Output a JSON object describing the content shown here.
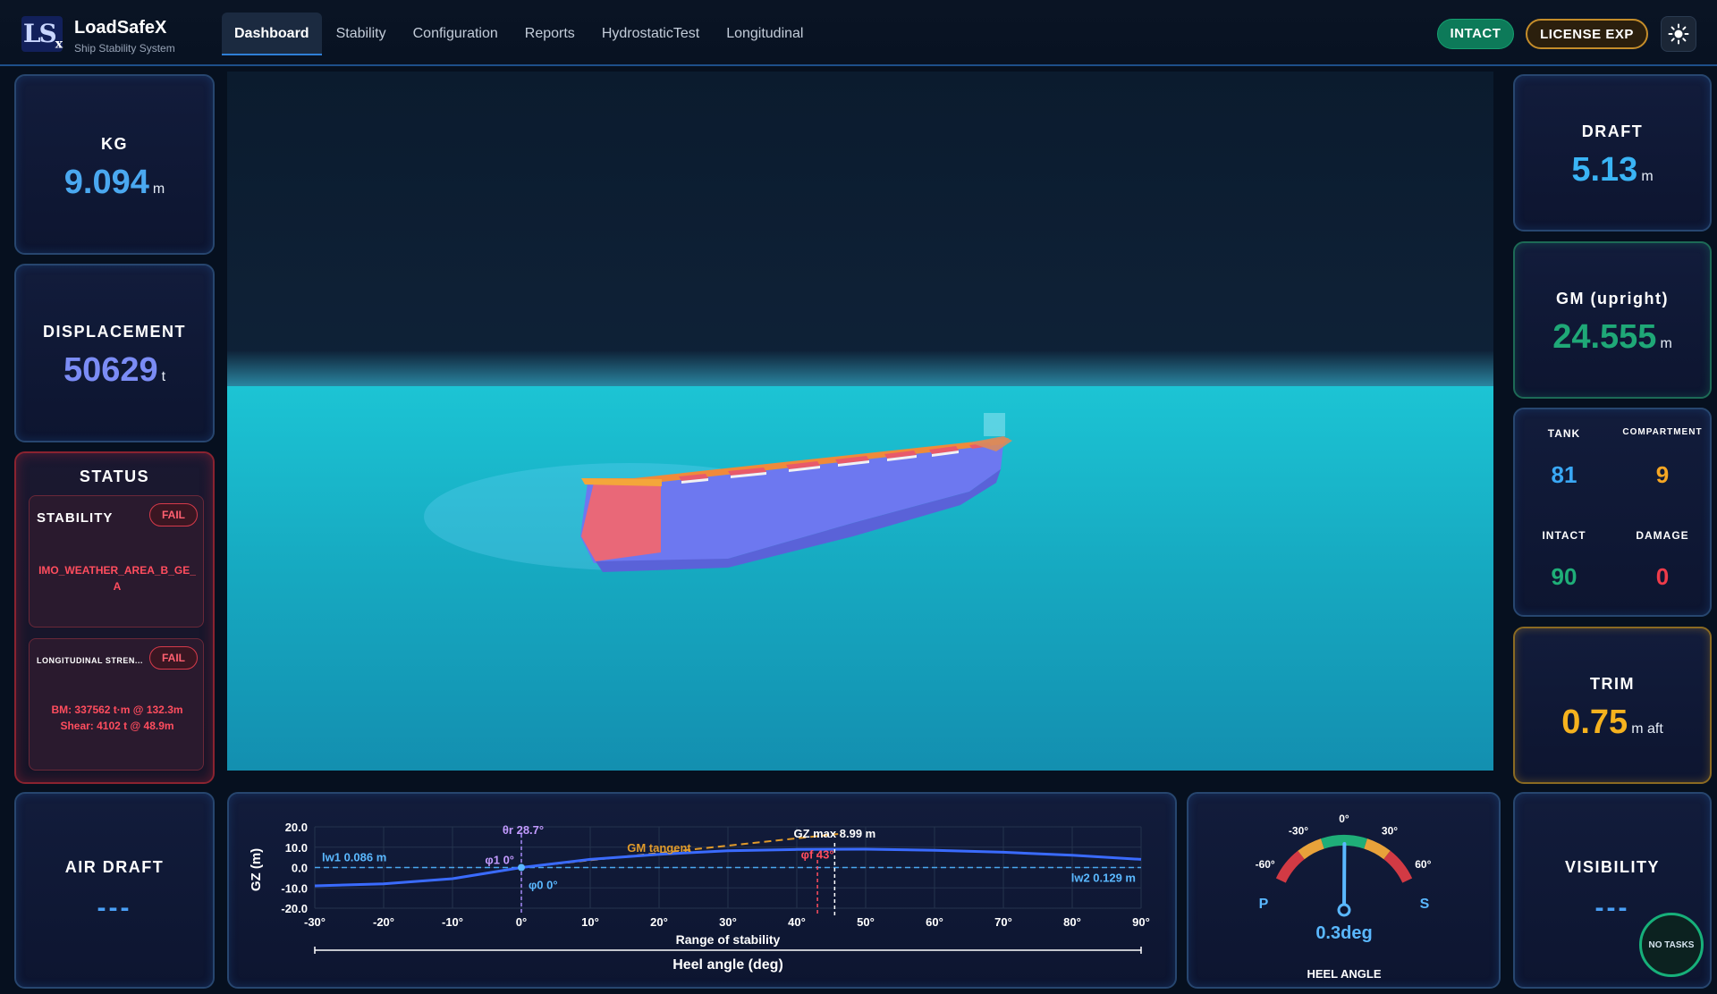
{
  "app": {
    "logo_text": "LS",
    "logo_sub": "x",
    "name": "LoadSafeX",
    "subtitle": "Ship Stability System"
  },
  "nav": {
    "tabs": [
      {
        "label": "Dashboard",
        "active": true
      },
      {
        "label": "Stability",
        "active": false
      },
      {
        "label": "Configuration",
        "active": false
      },
      {
        "label": "Reports",
        "active": false
      },
      {
        "label": "HydrostaticTest",
        "active": false
      },
      {
        "label": "Longitudinal",
        "active": false
      }
    ],
    "intact_badge": "INTACT",
    "license_badge": "LICENSE EXP",
    "theme_icon": "sun-icon"
  },
  "left": {
    "kg": {
      "title": "KG",
      "value": "9.094",
      "unit": "m",
      "color": "#4aa8f0"
    },
    "displacement": {
      "title": "DISPLACEMENT",
      "value": "50629",
      "unit": "t",
      "color": "#7b8cf5"
    },
    "status": {
      "title": "STATUS",
      "stability": {
        "title": "STABILITY",
        "badge": "FAIL",
        "detail": "IMO_WEATHER_AREA_B_GE_A"
      },
      "longitudinal": {
        "title": "LONGITUDINAL STREN...",
        "badge": "FAIL",
        "line1": "BM: 337562 t·m @ 132.3m",
        "line2": "Shear: 4102 t @ 48.9m"
      }
    },
    "air_draft": {
      "title": "AIR DRAFT",
      "value": "---"
    }
  },
  "right": {
    "draft": {
      "title": "DRAFT",
      "value": "5.13",
      "unit": "m",
      "color": "#3ab4f5"
    },
    "gm": {
      "title": "GM (upright)",
      "value": "24.555",
      "unit": "m",
      "color": "#1fa877"
    },
    "counts": {
      "tank": {
        "label": "TANK",
        "value": "81",
        "color": "#3aa8f5"
      },
      "compartment": {
        "label": "COMPARTMENT",
        "value": "9",
        "color": "#f5a623"
      },
      "intact": {
        "label": "INTACT",
        "value": "90",
        "color": "#1fae78"
      },
      "damage": {
        "label": "DAMAGE",
        "value": "0",
        "color": "#ee3b4a"
      }
    },
    "trim": {
      "title": "TRIM",
      "value": "0.75",
      "unit": "m aft",
      "color": "#f5b21e"
    },
    "visibility": {
      "title": "VISIBILITY",
      "value": "---"
    },
    "no_tasks": "NO TASKS"
  },
  "gauge": {
    "title": "HEEL ANGLE",
    "value_text": "0.3deg",
    "value": 0.3,
    "ticks": [
      "-60°",
      "-30°",
      "0°",
      "30°",
      "60°"
    ],
    "port_label": "P",
    "starboard_label": "S"
  },
  "chart_data": {
    "type": "line",
    "xlabel": "Heel angle (deg)",
    "ylabel": "GZ (m)",
    "xlim": [
      -30,
      90
    ],
    "ylim": [
      -20,
      20
    ],
    "x_ticks": [
      "-30°",
      "-20°",
      "-10°",
      "0°",
      "10°",
      "20°",
      "30°",
      "40°",
      "50°",
      "60°",
      "70°",
      "80°",
      "90°"
    ],
    "y_ticks": [
      "20.0",
      "10.0",
      "0.0",
      "-10.0",
      "-20.0"
    ],
    "series": [
      {
        "name": "GZ",
        "x": [
          -30,
          -20,
          -10,
          0,
          10,
          20,
          30,
          40,
          50,
          60,
          70,
          80,
          90
        ],
        "y": [
          -9.0,
          -8.0,
          -5.5,
          0.0,
          4.0,
          6.5,
          8.2,
          8.9,
          8.99,
          8.5,
          7.5,
          6.0,
          4.0
        ]
      }
    ],
    "gm_tangent": {
      "label": "GM tangent",
      "x": [
        0,
        46
      ],
      "y": [
        0,
        20
      ]
    },
    "annotations": [
      {
        "label": "θr 28.7°",
        "x": 0
      },
      {
        "label": "φ1 0°",
        "x": 0
      },
      {
        "label": "φ0 0°",
        "x": 0
      },
      {
        "label": "φf 43°",
        "x": 43
      },
      {
        "label": "GZ max 8.99 m",
        "x": 45.5
      },
      {
        "label": "lw1 0.086 m",
        "y": 0.086
      },
      {
        "label": "lw2 0.129 m",
        "y": 0.129
      }
    ],
    "range_label": "Range of stability",
    "range_x": [
      -30,
      90
    ]
  },
  "colors": {
    "accent": "#2f7fd6",
    "fail": "#ff4d5e",
    "sea": "#1cc4d4"
  }
}
